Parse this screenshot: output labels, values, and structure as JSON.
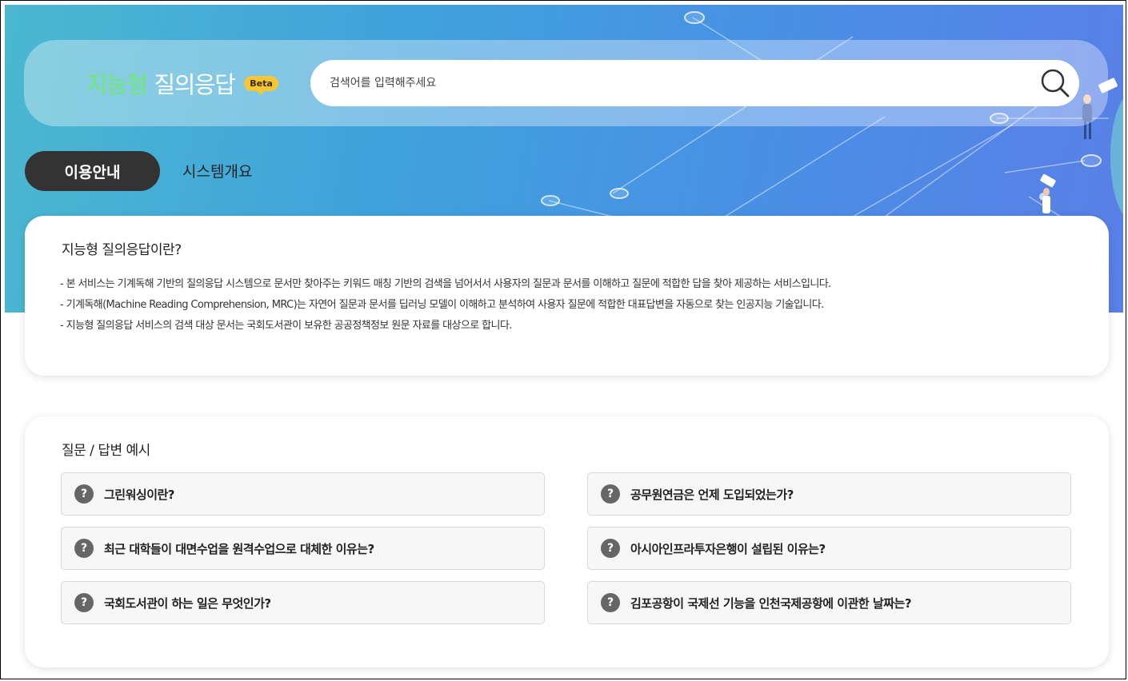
{
  "header": {
    "logo_part1": "지능형",
    "logo_part2": "질의응답",
    "beta_badge": "Beta",
    "search_placeholder": "검색어를 입력해주세요"
  },
  "tabs": [
    {
      "label": "이용안내",
      "active": true
    },
    {
      "label": "시스템개요",
      "active": false
    }
  ],
  "intro": {
    "title": "지능형 질의응답이란?",
    "lines": [
      "- 본 서비스는 기계독해 기반의 질의응답 시스템으로 문서만 찾아주는 키워드 매칭 기반의 검색을 넘어서서 사용자의 질문과 문서를 이해하고 질문에 적합한 답을 찾아 제공하는 서비스입니다.",
      "- 기계독해(Machine Reading Comprehension, MRC)는 자연어 질문과 문서를 딥러닝 모델이 이해하고 분석하여 사용자 질문에 적합한 대표답변을 자동으로 찾는 인공지능 기술입니다.",
      "- 지능형 질의응답 서비스의 검색 대상 문서는 국회도서관이 보유한 공공정책정보 원문 자료를 대상으로 합니다."
    ]
  },
  "examples": {
    "title": "질문 / 답변 예시",
    "icon_char": "?",
    "items": [
      "그린워싱이란?",
      "공무원연금은 언제 도입되었는가?",
      "최근 대학들이 대면수업을 원격수업으로 대체한 이유는?",
      "아시아인프라투자은행이 설립된 이유는?",
      "국회도서관이 하는 일은 무엇인가?",
      "김포공항이 국제선 기능을 인천국제공항에 이관한 날짜는?"
    ]
  },
  "colors": {
    "logo_accent": "#6ee872",
    "beta": "#f6c634",
    "active_tab": "#333333"
  }
}
